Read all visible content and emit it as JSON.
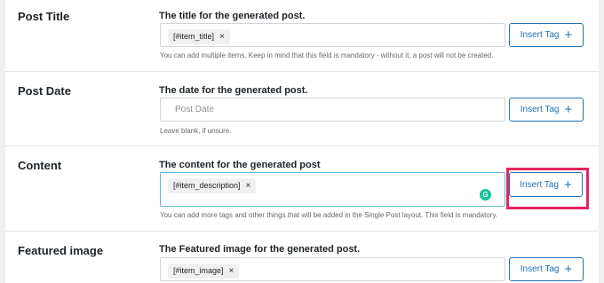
{
  "fields": [
    {
      "label": "Post Title",
      "title": "The title for the generated post.",
      "tag": "[#item_title]",
      "placeholder": "",
      "help": "You can add multiple items. Keep in mind that this field is mandatory - without it, a post will not be created.",
      "button": "Insert Tag"
    },
    {
      "label": "Post Date",
      "title": "The date for the generated post.",
      "tag": "",
      "placeholder": "Post Date",
      "help": "Leave blank, if unsure.",
      "button": "Insert Tag"
    },
    {
      "label": "Content",
      "title": "The content for the generated post",
      "tag": "[#item_description]",
      "placeholder": "",
      "help": "You can add more tags and other things that will be added in the Single Post layout. This field is mandatory.",
      "button": "Insert Tag"
    },
    {
      "label": "Featured image",
      "title": "The Featured image for the generated post.",
      "tag": "[#item_image]",
      "placeholder": "",
      "help": "",
      "button": "Insert Tag"
    }
  ],
  "icons": {
    "remove": "×",
    "plus": "+",
    "grammarly": "G"
  },
  "colors": {
    "accent": "#2271b1",
    "highlight": "#e5245d",
    "grammarly": "#15c39a"
  }
}
